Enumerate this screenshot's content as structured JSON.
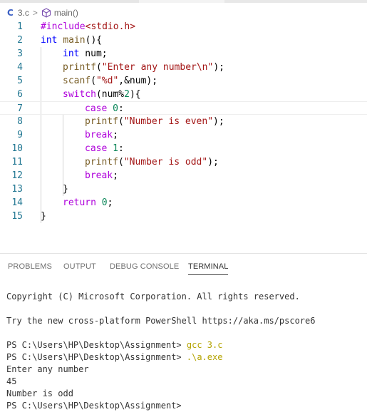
{
  "breadcrumb": {
    "lang_label": "C",
    "file": "3.c",
    "separator": ">",
    "symbol": "main()"
  },
  "editor": {
    "current_line": 7,
    "lines": [
      {
        "num": "1",
        "indent": 0,
        "tokens": [
          {
            "c": "k",
            "t": "#include"
          },
          {
            "c": "s",
            "t": "<stdio.h>"
          }
        ]
      },
      {
        "num": "2",
        "indent": 0,
        "tokens": [
          {
            "c": "t",
            "t": "int"
          },
          {
            "c": "p",
            "t": " "
          },
          {
            "c": "f",
            "t": "main"
          },
          {
            "c": "p",
            "t": "(){"
          }
        ]
      },
      {
        "num": "3",
        "indent": 1,
        "tokens": [
          {
            "c": "t",
            "t": "int"
          },
          {
            "c": "p",
            "t": " num;"
          }
        ]
      },
      {
        "num": "4",
        "indent": 1,
        "tokens": [
          {
            "c": "f",
            "t": "printf"
          },
          {
            "c": "p",
            "t": "("
          },
          {
            "c": "s",
            "t": "\"Enter any number\\n\""
          },
          {
            "c": "p",
            "t": ");"
          }
        ]
      },
      {
        "num": "5",
        "indent": 1,
        "tokens": [
          {
            "c": "f",
            "t": "scanf"
          },
          {
            "c": "p",
            "t": "("
          },
          {
            "c": "s",
            "t": "\"%d\""
          },
          {
            "c": "p",
            "t": ",&num);"
          }
        ]
      },
      {
        "num": "6",
        "indent": 1,
        "tokens": [
          {
            "c": "k",
            "t": "switch"
          },
          {
            "c": "p",
            "t": "(num%"
          },
          {
            "c": "n",
            "t": "2"
          },
          {
            "c": "p",
            "t": "){"
          }
        ]
      },
      {
        "num": "7",
        "indent": 2,
        "tokens": [
          {
            "c": "k",
            "t": "case"
          },
          {
            "c": "p",
            "t": " "
          },
          {
            "c": "n",
            "t": "0"
          },
          {
            "c": "p",
            "t": ":"
          }
        ]
      },
      {
        "num": "8",
        "indent": 2,
        "tokens": [
          {
            "c": "f",
            "t": "printf"
          },
          {
            "c": "p",
            "t": "("
          },
          {
            "c": "s",
            "t": "\"Number is even\""
          },
          {
            "c": "p",
            "t": ");"
          }
        ]
      },
      {
        "num": "9",
        "indent": 2,
        "tokens": [
          {
            "c": "k",
            "t": "break"
          },
          {
            "c": "p",
            "t": ";"
          }
        ]
      },
      {
        "num": "10",
        "indent": 2,
        "tokens": [
          {
            "c": "k",
            "t": "case"
          },
          {
            "c": "p",
            "t": " "
          },
          {
            "c": "n",
            "t": "1"
          },
          {
            "c": "p",
            "t": ":"
          }
        ]
      },
      {
        "num": "11",
        "indent": 2,
        "tokens": [
          {
            "c": "f",
            "t": "printf"
          },
          {
            "c": "p",
            "t": "("
          },
          {
            "c": "s",
            "t": "\"Number is odd\""
          },
          {
            "c": "p",
            "t": ");"
          }
        ]
      },
      {
        "num": "12",
        "indent": 2,
        "tokens": [
          {
            "c": "k",
            "t": "break"
          },
          {
            "c": "p",
            "t": ";"
          }
        ]
      },
      {
        "num": "13",
        "indent": 1,
        "tokens": [
          {
            "c": "p",
            "t": "}"
          }
        ]
      },
      {
        "num": "14",
        "indent": 1,
        "tokens": [
          {
            "c": "k",
            "t": "return"
          },
          {
            "c": "p",
            "t": " "
          },
          {
            "c": "n",
            "t": "0"
          },
          {
            "c": "p",
            "t": ";"
          }
        ]
      },
      {
        "num": "15",
        "indent": 0,
        "tokens": [
          {
            "c": "p",
            "t": "}"
          }
        ]
      }
    ]
  },
  "panel": {
    "tabs": [
      {
        "label": "PROBLEMS",
        "active": false
      },
      {
        "label": "OUTPUT",
        "active": false
      },
      {
        "label": "DEBUG CONSOLE",
        "active": false
      },
      {
        "label": "TERMINAL",
        "active": true
      }
    ]
  },
  "terminal": {
    "lines": [
      {
        "text": "Copyright (C) Microsoft Corporation. All rights reserved."
      },
      {
        "text": ""
      },
      {
        "text": "Try the new cross-platform PowerShell https://aka.ms/pscore6"
      },
      {
        "text": ""
      },
      {
        "text": "PS C:\\Users\\HP\\Desktop\\Assignment> ",
        "cmd": "gcc 3.c"
      },
      {
        "text": "PS C:\\Users\\HP\\Desktop\\Assignment> ",
        "cmd": ".\\a.exe"
      },
      {
        "text": "Enter any number"
      },
      {
        "text": "45"
      },
      {
        "text": "Number is odd"
      },
      {
        "text": "PS C:\\Users\\HP\\Desktop\\Assignment> "
      }
    ]
  },
  "colors": {
    "keyword": "#af00db",
    "type": "#0000ff",
    "function": "#795e26",
    "string": "#a31515",
    "number": "#098658",
    "line_number": "#237893",
    "terminal_command": "#b4a300"
  }
}
